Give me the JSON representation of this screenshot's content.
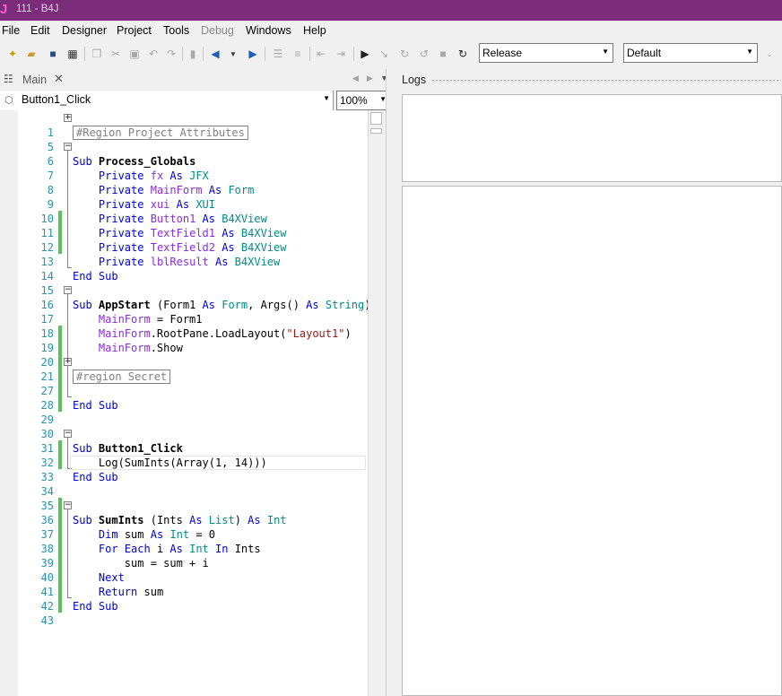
{
  "window": {
    "title": "111 - B4J",
    "app_icon_glyph": "J"
  },
  "menu": {
    "file": "File",
    "edit": "Edit",
    "designer": "Designer",
    "project": "Project",
    "tools": "Tools",
    "debug": "Debug",
    "windows": "Windows",
    "help": "Help"
  },
  "toolbar": {
    "build_config": "Release",
    "device": "Default"
  },
  "tabs": {
    "main_label": "Main"
  },
  "subbar": {
    "method": "Button1_Click",
    "zoom": "100%"
  },
  "logs": {
    "title": "Logs"
  },
  "colors": {
    "titlebar": "#7b2d7b",
    "keyword": "#0000d8",
    "type": "#008b8b",
    "identifier": "#8a2be2",
    "string": "#a31515",
    "line_number": "#2b91af",
    "change_bar": "#57c257"
  },
  "code": {
    "l1": {
      "num": "1",
      "text": "#Region Project Attributes"
    },
    "l5": {
      "num": "5"
    },
    "l6": {
      "num": "6",
      "kw": "Sub",
      "name": "Process_Globals"
    },
    "l7": {
      "num": "7",
      "kw": "Private",
      "var": "fx",
      "as": "As",
      "type": "JFX"
    },
    "l8": {
      "num": "8",
      "kw": "Private",
      "var": "MainForm",
      "as": "As",
      "type": "Form"
    },
    "l9": {
      "num": "9",
      "kw": "Private",
      "var": "xui",
      "as": "As",
      "type": "XUI"
    },
    "l10": {
      "num": "10",
      "kw": "Private",
      "var": "Button1",
      "as": "As",
      "type": "B4XView"
    },
    "l11": {
      "num": "11",
      "kw": "Private",
      "var": "TextField1",
      "as": "As",
      "type": "B4XView"
    },
    "l12": {
      "num": "12",
      "kw": "Private",
      "var": "TextField2",
      "as": "As",
      "type": "B4XView"
    },
    "l13": {
      "num": "13",
      "kw": "Private",
      "var": "lblResult",
      "as": "As",
      "type": "B4XView"
    },
    "l14": {
      "num": "14",
      "text": "End Sub"
    },
    "l15": {
      "num": "15"
    },
    "l16": {
      "num": "16",
      "kw": "Sub",
      "name": "AppStart",
      "p1": "(Form1",
      "as1": "As",
      "t1": "Form",
      "p2": ", Args()",
      "as2": "As",
      "t2": "String",
      "p3": ")"
    },
    "l17": {
      "num": "17",
      "var": "MainForm",
      "rest": " = Form1"
    },
    "l18": {
      "num": "18",
      "var": "MainForm",
      "mid": ".RootPane.LoadLayout(",
      "str": "\"Layout1\"",
      "end": ")"
    },
    "l19": {
      "num": "19",
      "var": "MainForm",
      "rest": ".Show"
    },
    "l20": {
      "num": "20"
    },
    "l21": {
      "num": "21",
      "text": "#region Secret"
    },
    "l27": {
      "num": "27"
    },
    "l28": {
      "num": "28",
      "text": "End Sub"
    },
    "l29": {
      "num": "29"
    },
    "l30": {
      "num": "30"
    },
    "l31": {
      "num": "31",
      "kw": "Sub",
      "name": "Button1_Click"
    },
    "l32": {
      "num": "32",
      "text": "Log(SumInts(Array(1, 14)))"
    },
    "l33": {
      "num": "33",
      "text": "End Sub"
    },
    "l34": {
      "num": "34"
    },
    "l35": {
      "num": "35"
    },
    "l36": {
      "num": "36",
      "kw": "Sub",
      "name": "SumInts",
      "p1": "(Ints",
      "as1": "As",
      "t1": "List",
      "p2": ")",
      "as2": "As",
      "t2": "Int"
    },
    "l37": {
      "num": "37",
      "kw": "Dim",
      "v": "sum",
      "as": "As",
      "type": "Int",
      "rest": " = 0"
    },
    "l38": {
      "num": "38",
      "kw": "For Each",
      "v": "i",
      "as": "As",
      "type": "Int",
      "in": "In",
      "rest": "Ints"
    },
    "l39": {
      "num": "39",
      "text": "sum = sum + i"
    },
    "l40": {
      "num": "40",
      "text": "Next"
    },
    "l41": {
      "num": "41",
      "kw": "Return",
      "rest": " sum"
    },
    "l42": {
      "num": "42",
      "text": "End Sub"
    },
    "l43": {
      "num": "43"
    }
  }
}
